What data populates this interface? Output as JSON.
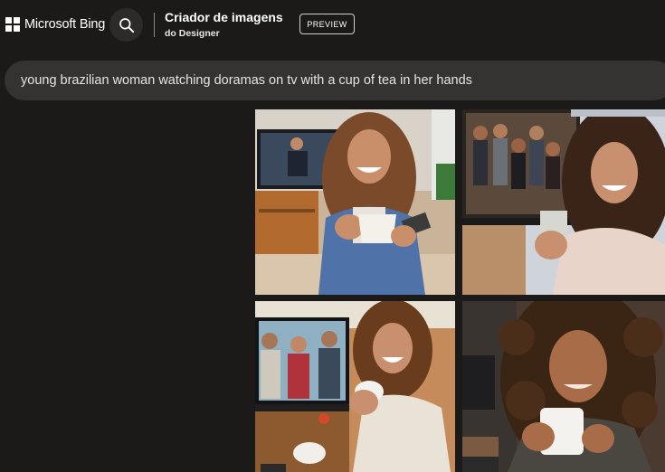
{
  "header": {
    "brand": "Microsoft Bing",
    "app_title": "Criador de imagens",
    "app_subtitle": "do Designer",
    "badge": "PREVIEW",
    "search_icon": "search-icon"
  },
  "prompt": {
    "text": "young brazilian woman watching doramas on tv with a cup of tea in her hands"
  },
  "results": {
    "images": [
      {
        "label": "generated-image-1",
        "alt": "Woman smiling with a cup and remote in front of a TV"
      },
      {
        "label": "generated-image-2",
        "alt": "Woman in robe with a mug, group of people on TV behind"
      },
      {
        "label": "generated-image-3",
        "alt": "Woman laughing holding a cup, TV showing three people"
      },
      {
        "label": "generated-image-4",
        "alt": "Curly-haired woman holding a white mug"
      }
    ]
  },
  "colors": {
    "background": "#1b1a19",
    "prompt_bar": "#343331",
    "search_button": "#2c2b2a"
  }
}
